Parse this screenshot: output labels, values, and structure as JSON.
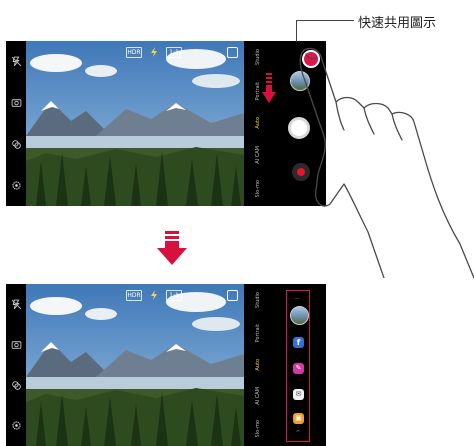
{
  "callout": {
    "label": "快速共用圖示"
  },
  "modes": [
    "Studio",
    "Portrait",
    "Auto",
    "AI CAM",
    "Slo-mo"
  ],
  "active_mode_index": 2,
  "top_bar": {
    "chip_left": "HDR",
    "chip_right": "1:1"
  },
  "shortcut_panel": {
    "dots": "...",
    "apps": [
      {
        "name": "facebook",
        "color": "#3b6fd8",
        "glyph": "f"
      },
      {
        "name": "pen",
        "color": "#cf3aa5",
        "glyph": "✎"
      },
      {
        "name": "mail",
        "color": "#f0f0f0",
        "glyph": "✉"
      },
      {
        "name": "gallery",
        "color": "#f0a028",
        "glyph": "▣"
      }
    ],
    "expand_glyph": "⌃"
  },
  "colors": {
    "accent": "#e0164a",
    "frame": "#d3184f",
    "record": "#e3162a",
    "arrow": "#d8103c"
  }
}
